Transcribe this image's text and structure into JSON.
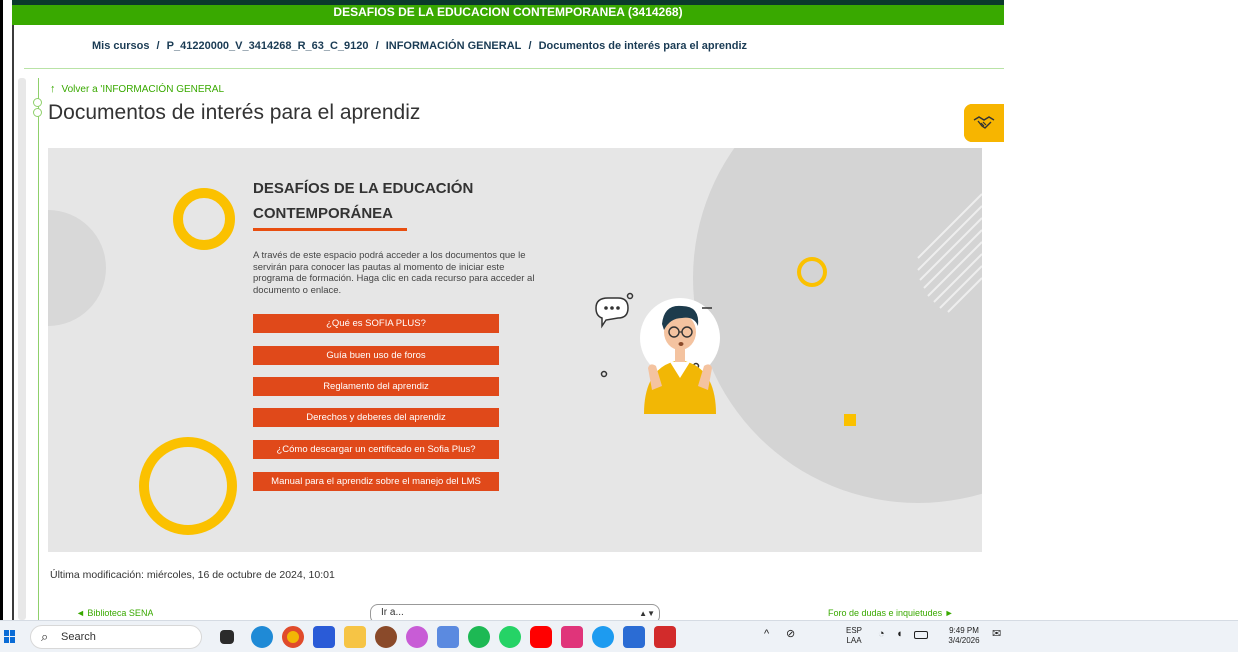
{
  "course_header": {
    "title": "DESAFIOS DE LA EDUCACION CONTEMPORANEA (3414268)"
  },
  "breadcrumb": {
    "items": [
      "Mis cursos",
      "P_41220000_V_3414268_R_63_C_9120",
      "INFORMACIÓN GENERAL",
      "Documentos de interés para el aprendiz"
    ],
    "separator": "/"
  },
  "back_link": "Volver a 'INFORMACIÓN GENERAL",
  "page_title": "Documentos de interés para el aprendiz",
  "banner": {
    "heading_line1": "DESAFÍOS DE LA EDUCACIÓN",
    "heading_line2": "CONTEMPORÁNEA",
    "description": "A través de este espacio podrá acceder a los documentos que le servirán para conocer las pautas al momento de iniciar este programa de formación. Haga clic en cada recurso para acceder al documento o enlace.",
    "buttons": [
      "¿Qué es SOFIA PLUS?",
      "Guía buen uso de foros",
      "Reglamento del aprendiz",
      "Derechos y deberes del aprendiz",
      "¿Cómo descargar un certificado en Sofia Plus?",
      "Manual para el aprendiz sobre el manejo del LMS"
    ]
  },
  "last_modified": "Última modificación: miércoles, 16 de octubre de 2024, 10:01",
  "navigation": {
    "prev_link": "◄ Biblioteca SENA",
    "jump_placeholder": "Ir a...",
    "next_link": "Foro de dudas e inquietudes ►"
  },
  "taskbar": {
    "search_label": "Search",
    "language_line1": "ESP",
    "language_line2": "LAA",
    "time": "9:49 PM",
    "date": "3/4/2026"
  },
  "colors": {
    "sena_green": "#39a900",
    "button_orange": "#e0491a",
    "accent_yellow": "#f7b500"
  }
}
